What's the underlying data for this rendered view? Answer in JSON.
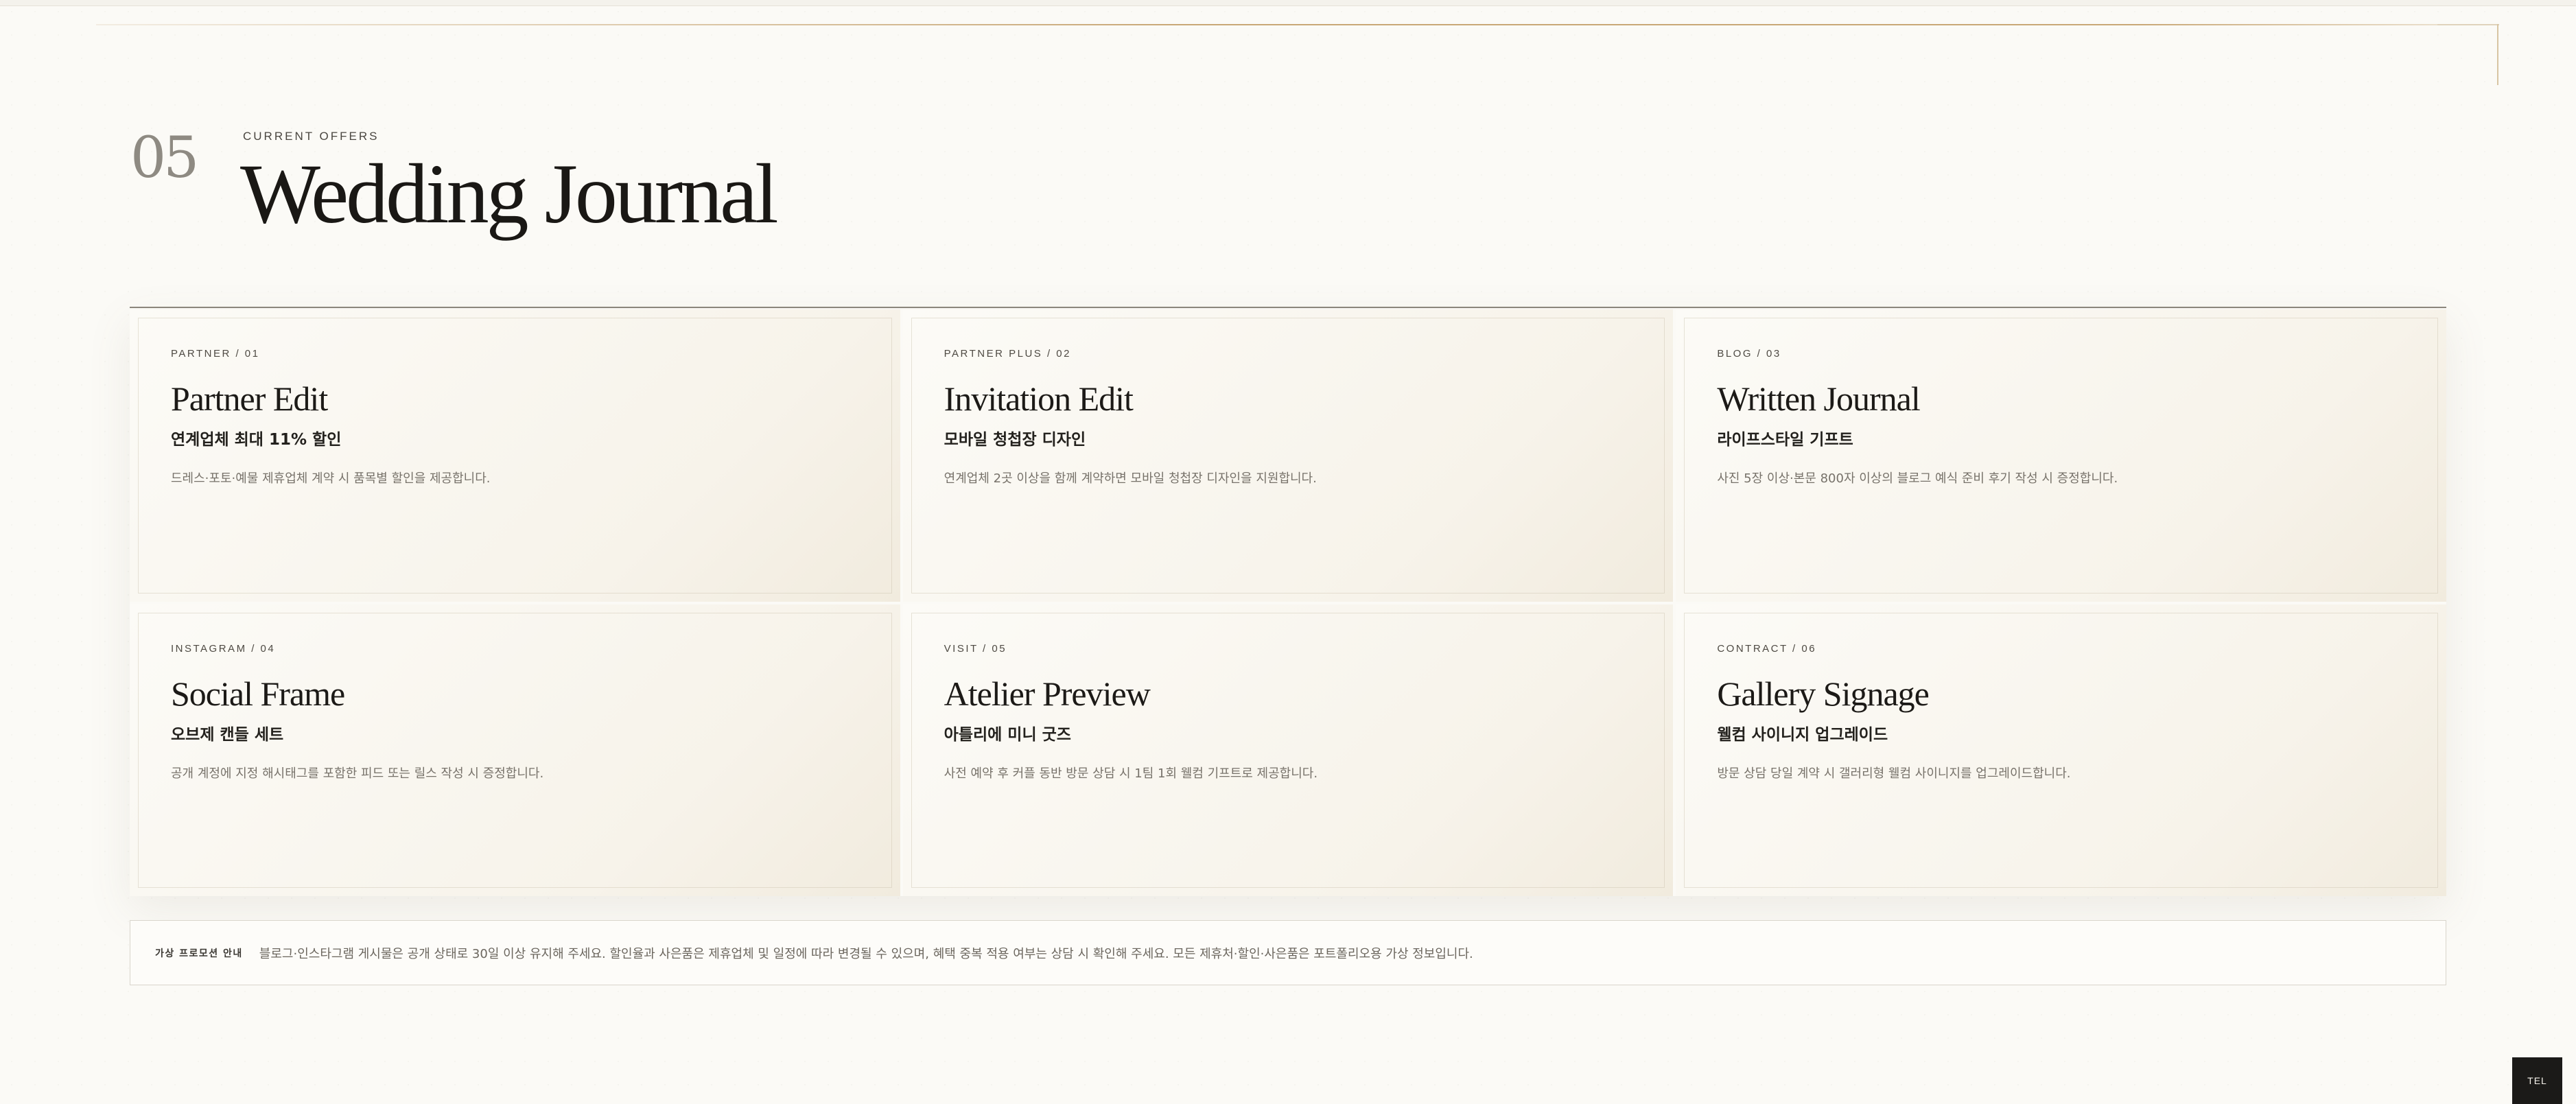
{
  "section": {
    "number": "05",
    "eyebrow": "CURRENT OFFERS",
    "title": "Wedding Journal"
  },
  "cards": [
    {
      "tag": "PARTNER / 01",
      "title": "Partner Edit",
      "subtitle": "연계업체 최대 11% 할인",
      "description": "드레스·포토·예물 제휴업체 계약 시 품목별 할인을 제공합니다."
    },
    {
      "tag": "PARTNER PLUS / 02",
      "title": "Invitation Edit",
      "subtitle": "모바일 청첩장 디자인",
      "description": "연계업체 2곳 이상을 함께 계약하면 모바일 청첩장 디자인을 지원합니다."
    },
    {
      "tag": "BLOG / 03",
      "title": "Written Journal",
      "subtitle": "라이프스타일 기프트",
      "description": "사진 5장 이상·본문 800자 이상의 블로그 예식 준비 후기 작성 시 증정합니다."
    },
    {
      "tag": "INSTAGRAM / 04",
      "title": "Social Frame",
      "subtitle": "오브제 캔들 세트",
      "description": "공개 계정에 지정 해시태그를 포함한 피드 또는 릴스 작성 시 증정합니다."
    },
    {
      "tag": "VISIT / 05",
      "title": "Atelier Preview",
      "subtitle": "아틀리에 미니 굿즈",
      "description": "사전 예약 후 커플 동반 방문 상담 시 1팀 1회 웰컴 기프트로 제공합니다."
    },
    {
      "tag": "CONTRACT / 06",
      "title": "Gallery Signage",
      "subtitle": "웰컴 사이니지 업그레이드",
      "description": "방문 상담 당일 계약 시 갤러리형 웰컴 사이니지를 업그레이드합니다."
    }
  ],
  "notice": {
    "label": "가상 프로모션 안내",
    "text": "블로그·인스타그램 게시물은 공개 상태로 30일 이상 유지해 주세요. 할인율과 사은품은 제휴업체 및 일정에 따라 변경될 수 있으며, 혜택 중복 적용 여부는 상담 시 확인해 주세요. 모든 제휴처·할인·사은품은 포트폴리오용 가상 정보입니다."
  },
  "tel_button": "TEL",
  "colors": {
    "background": "#fbfaf6",
    "accent_gold": "#c9a877",
    "tel_button_bg": "#1b1a18"
  }
}
